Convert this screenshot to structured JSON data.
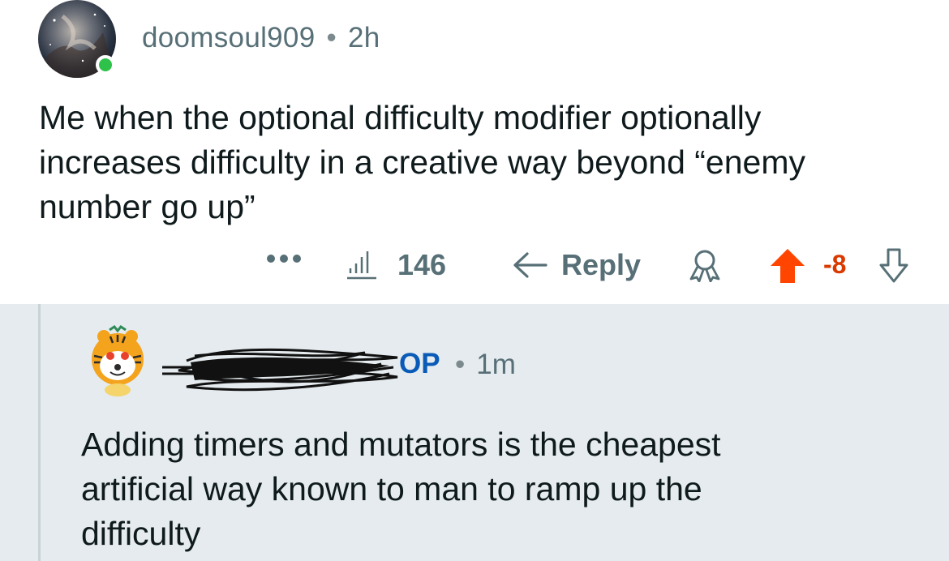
{
  "top_comment": {
    "username": "doomsoul909",
    "separator": "•",
    "age": "2h",
    "body_lines": [
      "Me when the optional difficulty modifier optionally",
      "increases difficulty in a creative way beyond “enemy",
      "number go up”"
    ],
    "actions": {
      "more_icon": "more-icon",
      "stats_icon": "bar-chart-icon",
      "stats_count": "146",
      "reply_icon": "reply-arrow-icon",
      "reply_label": "Reply",
      "award_icon": "award-icon",
      "upvote_icon": "upvote-arrow-icon",
      "score": "-8",
      "downvote_icon": "downvote-arrow-icon"
    }
  },
  "reply_comment": {
    "op_badge": "OP",
    "separator": "•",
    "age": "1m",
    "body_lines": [
      "Adding timers and mutators is the cheapest",
      "artificial way known to man to ramp up the",
      "difficulty"
    ]
  },
  "colors": {
    "upvote_active": "#ff4500",
    "score": "#d93a00",
    "op_badge": "#0a5bb8",
    "online": "#2ec24a",
    "thread_bg": "#e5ebee"
  }
}
